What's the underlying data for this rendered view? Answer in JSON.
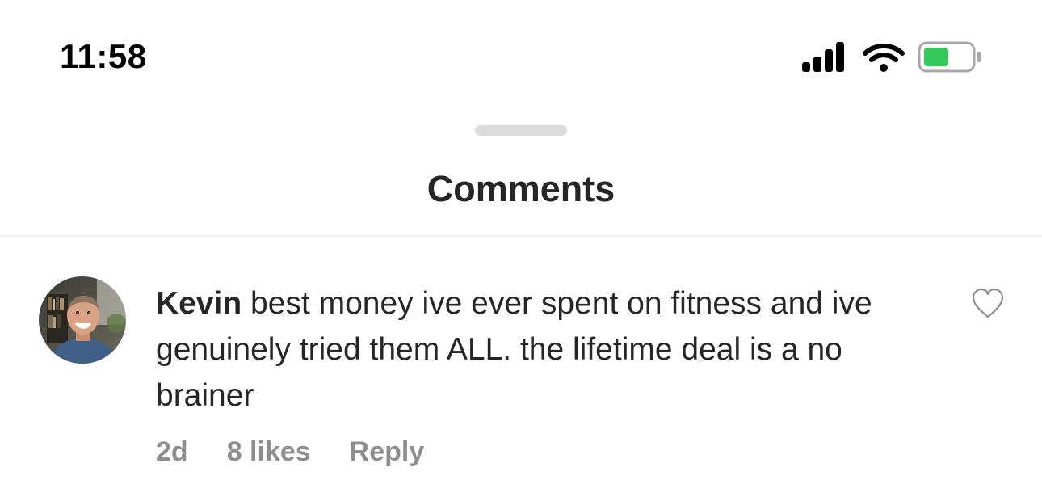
{
  "status_bar": {
    "time": "11:58",
    "icons": [
      "signal-icon",
      "wifi-icon",
      "battery-icon"
    ],
    "battery_color": "#34c759"
  },
  "sheet": {
    "title": "Comments"
  },
  "comment": {
    "username": "Kevin",
    "text": "best money ive ever spent on fitness and ive genuinely tried them ALL. the lifetime deal is a no brainer",
    "time": "2d",
    "likes": "8 likes",
    "reply_label": "Reply",
    "like_icon": "heart-outline-icon"
  },
  "colors": {
    "text_primary": "#262626",
    "text_secondary": "#8e8e8e",
    "divider": "#efefef",
    "grabber": "#dbdbdb"
  }
}
